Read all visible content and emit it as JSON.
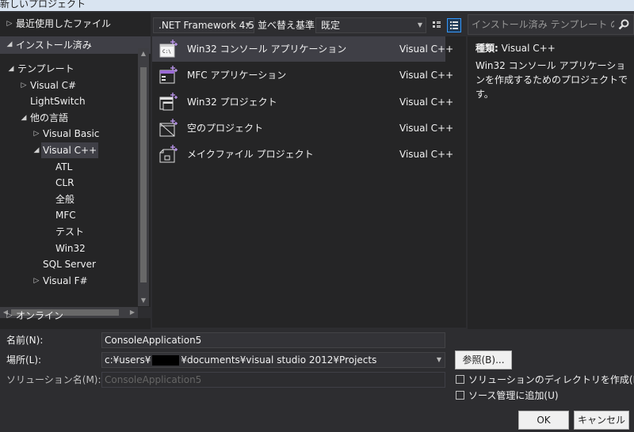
{
  "window": {
    "title": "新しいプロジェクト"
  },
  "left": {
    "sections": {
      "recent": "最近使用したファイル",
      "installed": "インストール済み",
      "online": "オンライン"
    },
    "tree": [
      {
        "label": "テンプレート",
        "arrow": "◢"
      },
      {
        "label": "Visual C#",
        "arrow": "▷"
      },
      {
        "label": "LightSwitch",
        "arrow": ""
      },
      {
        "label": "他の言語",
        "arrow": "◢"
      },
      {
        "label": "Visual Basic",
        "arrow": "▷"
      },
      {
        "label": "Visual C++",
        "arrow": "◢",
        "selected": true
      },
      {
        "label": "ATL",
        "arrow": ""
      },
      {
        "label": "CLR",
        "arrow": ""
      },
      {
        "label": "全般",
        "arrow": ""
      },
      {
        "label": "MFC",
        "arrow": ""
      },
      {
        "label": "テスト",
        "arrow": ""
      },
      {
        "label": "Win32",
        "arrow": ""
      },
      {
        "label": "SQL Server",
        "arrow": ""
      },
      {
        "label": "Visual F#",
        "arrow": "▷"
      }
    ]
  },
  "toolbar": {
    "framework": ".NET Framework 4.5",
    "sort_label": "並べ替え基準:",
    "sort_value": "既定"
  },
  "search": {
    "placeholder": "インストール済み テンプレート の検索"
  },
  "templates": [
    {
      "name": "Win32 コンソール アプリケーション",
      "lang": "Visual C++",
      "icon": "console-app-icon",
      "selected": true
    },
    {
      "name": "MFC アプリケーション",
      "lang": "Visual C++",
      "icon": "mfc-app-icon"
    },
    {
      "name": "Win32 プロジェクト",
      "lang": "Visual C++",
      "icon": "win32-project-icon"
    },
    {
      "name": "空のプロジェクト",
      "lang": "Visual C++",
      "icon": "empty-project-icon"
    },
    {
      "name": "メイクファイル プロジェクト",
      "lang": "Visual C++",
      "icon": "makefile-project-icon"
    }
  ],
  "info": {
    "type_key": "種類:",
    "type_value": "Visual C++",
    "description": "Win32 コンソール アプリケーションを作成するためのプロジェクトです。"
  },
  "form": {
    "name_label": "名前(N):",
    "name_value": "ConsoleApplication5",
    "location_label": "場所(L):",
    "location_prefix": "c:¥users¥",
    "location_suffix": "¥documents¥visual studio 2012¥Projects",
    "solution_label": "ソリューション名(M):",
    "solution_value": "ConsoleApplication5",
    "browse_label": "参照(B)...",
    "create_dir_label": "ソリューションのディレクトリを作成(D)",
    "source_control_label": "ソース管理に追加(U)",
    "ok_label": "OK",
    "cancel_label": "キャンセル"
  },
  "colors": {
    "background": "#2d2d30",
    "pane": "#252526",
    "selection": "#3f3f46",
    "accent": "#3399ff",
    "icon_star": "#c9a0ff"
  }
}
